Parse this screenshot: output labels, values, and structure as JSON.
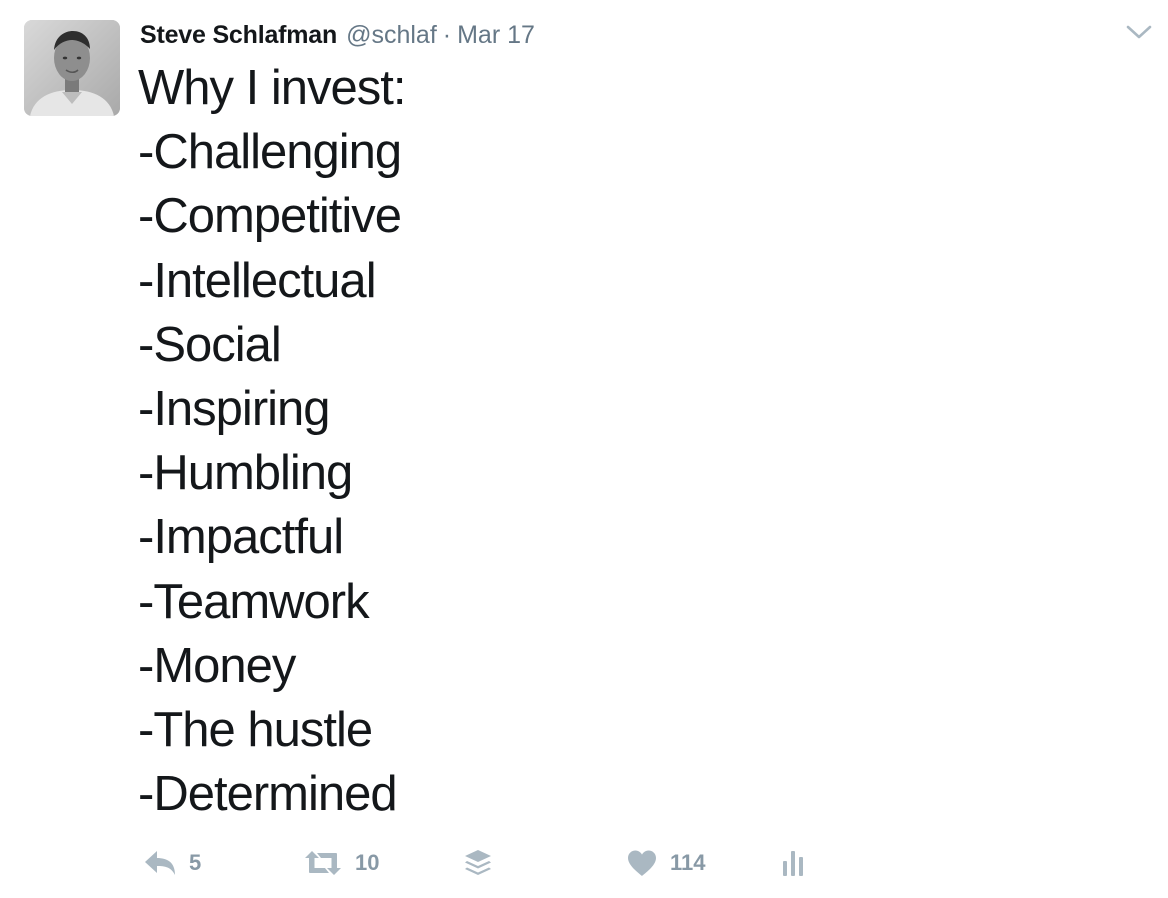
{
  "tweet": {
    "author": {
      "full_name": "Steve Schlafman",
      "screen_name": "@schlaf"
    },
    "separator": "·",
    "timestamp": "Mar 17",
    "lines": [
      "Why I invest:",
      "-Challenging",
      "-Competitive",
      "-Intellectual",
      "-Social",
      "-Inspiring",
      "-Humbling",
      "-Impactful",
      "-Teamwork",
      "-Money",
      "-The hustle",
      "-Determined"
    ],
    "actions": {
      "reply_count": "5",
      "retweet_count": "10",
      "like_count": "114"
    }
  },
  "icons": {
    "caret": "chevron-down-icon",
    "reply": "reply-icon",
    "retweet": "retweet-icon",
    "buffer": "buffer-stack-icon",
    "like": "heart-icon",
    "analytics": "analytics-bars-icon"
  },
  "colors": {
    "text": "#14171a",
    "secondary": "#657786",
    "action_icon": "#aab8c2",
    "action_count": "#8899a6"
  }
}
